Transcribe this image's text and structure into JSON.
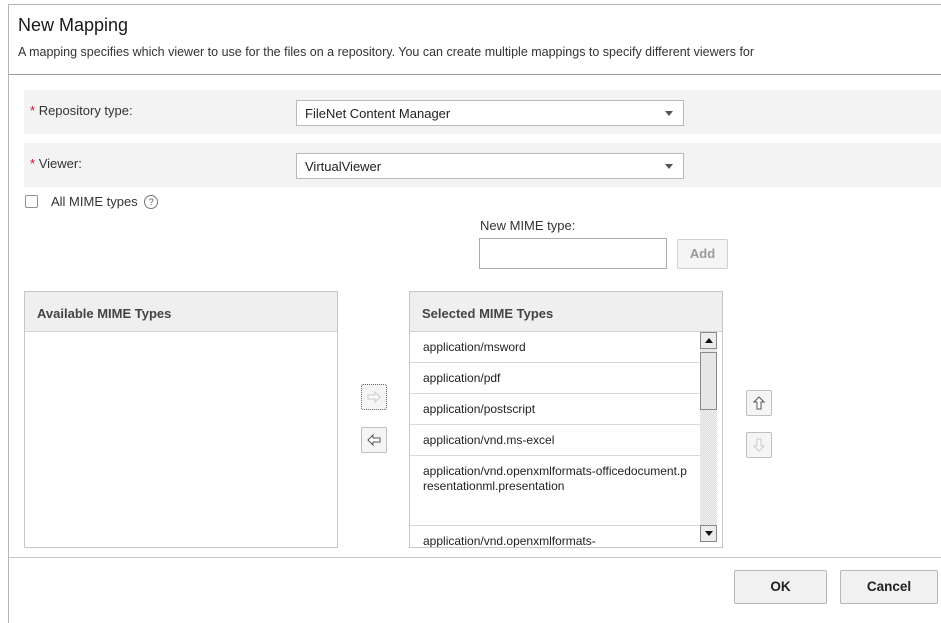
{
  "dialog": {
    "title": "New Mapping",
    "description": "A mapping specifies which viewer to use for the files on a repository. You can create multiple mappings to specify different viewers for"
  },
  "repository": {
    "required_marker": "*",
    "label": "Repository type:",
    "value": "FileNet Content Manager"
  },
  "viewer": {
    "required_marker": "*",
    "label": "Viewer:",
    "value": "VirtualViewer"
  },
  "all_mime": {
    "label": "All MIME types",
    "checked": false,
    "help_glyph": "?"
  },
  "new_mime": {
    "label": "New MIME type:",
    "value": "",
    "add_label": "Add"
  },
  "available": {
    "header": "Available MIME Types",
    "items": []
  },
  "selected": {
    "header": "Selected MIME Types",
    "items": [
      "application/msword",
      "application/pdf",
      "application/postscript",
      "application/vnd.ms-excel",
      "application/vnd.openxmlformats-officedocument.presentationml.presentation",
      "application/vnd.openxmlformats-"
    ]
  },
  "icons": {
    "move_right": "arrow-right-icon",
    "move_left": "arrow-left-icon",
    "move_up": "arrow-up-icon",
    "move_down": "arrow-down-icon"
  },
  "colors": {
    "required": "#c8102e",
    "row_bg": "#f3f3f3",
    "header_bg": "#efefef"
  },
  "footer": {
    "ok_label": "OK",
    "cancel_label": "Cancel"
  }
}
